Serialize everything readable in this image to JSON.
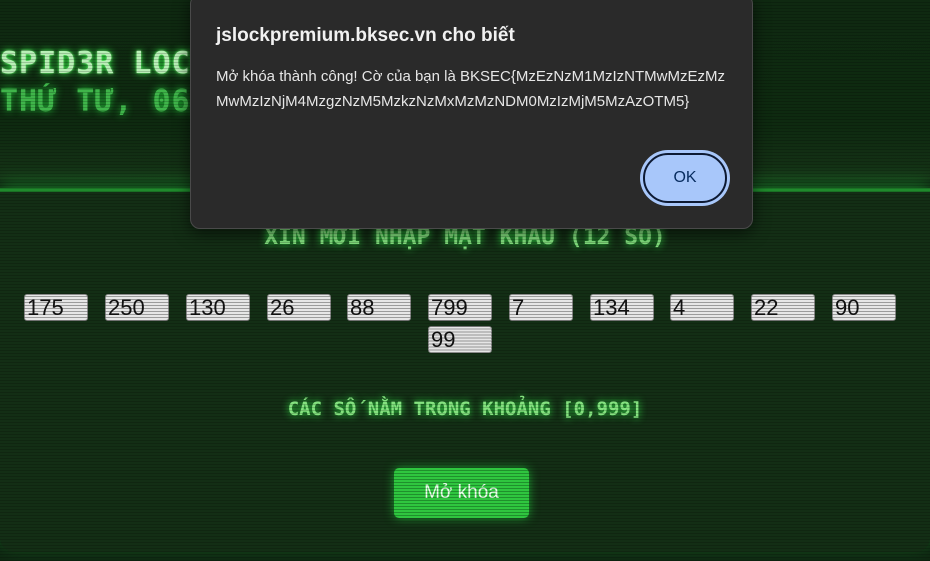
{
  "header": {
    "title": "SPID3R LOCK",
    "date": "THỨ TƯ, 06/0"
  },
  "main": {
    "prompt": "XIN MỜI NHẬP MẬT KHẨU (12 SỐ)",
    "inputs": [
      "175",
      "250",
      "130",
      "26",
      "88",
      "799",
      "7",
      "134",
      "4",
      "22",
      "90",
      "99"
    ],
    "range_note": "CÁC SỐ NẰM TRONG KHOẢNG [0,999]",
    "unlock_label": "Mở khóa"
  },
  "dialog": {
    "title": "jslockpremium.bksec.vn cho biết",
    "message": "Mở khóa thành công! Cờ của bạn là BKSEC{MzEzNzM1MzIzNTMwMzEzMzMwMzIzNjM4MzgzNzM5MzkzNzMxMzMzNDM0MzIzMjM5MzAzOTM5}",
    "ok_label": "OK"
  },
  "colors": {
    "accent_green": "#2fc63f",
    "dialog_bg": "#2a2a2a",
    "ok_button": "#a8c7fa"
  }
}
